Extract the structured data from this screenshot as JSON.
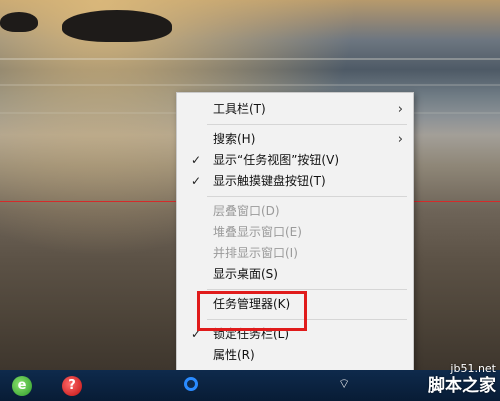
{
  "context_menu": {
    "items": [
      {
        "label": "工具栏(T)",
        "checked": false,
        "submenu": true,
        "enabled": true
      },
      {
        "separator": true
      },
      {
        "label": "搜索(H)",
        "checked": false,
        "submenu": true,
        "enabled": true
      },
      {
        "label": "显示“任务视图”按钮(V)",
        "checked": true,
        "submenu": false,
        "enabled": true
      },
      {
        "label": "显示触摸键盘按钮(T)",
        "checked": true,
        "submenu": false,
        "enabled": true
      },
      {
        "separator": true
      },
      {
        "label": "层叠窗口(D)",
        "checked": false,
        "submenu": false,
        "enabled": false
      },
      {
        "label": "堆叠显示窗口(E)",
        "checked": false,
        "submenu": false,
        "enabled": false
      },
      {
        "label": "并排显示窗口(I)",
        "checked": false,
        "submenu": false,
        "enabled": false
      },
      {
        "label": "显示桌面(S)",
        "checked": false,
        "submenu": false,
        "enabled": true
      },
      {
        "separator": true
      },
      {
        "label": "任务管理器(K)",
        "checked": false,
        "submenu": false,
        "enabled": true,
        "highlighted": true
      },
      {
        "separator": true
      },
      {
        "label": "锁定任务栏(L)",
        "checked": true,
        "submenu": false,
        "enabled": true
      },
      {
        "label": "属性(R)",
        "checked": false,
        "submenu": false,
        "enabled": true
      }
    ],
    "check_glyph": "✓",
    "submenu_glyph": "›"
  },
  "taskbar": {
    "ie_icon": "e",
    "help_icon": "?",
    "wifi_glyph": "⌔"
  },
  "watermark": {
    "url": "jb51.net",
    "name": "脚本之家"
  },
  "colors": {
    "highlight_border": "#e01b1b",
    "taskbar": "#0e2a4c",
    "menu_bg": "#f2f2f2"
  }
}
